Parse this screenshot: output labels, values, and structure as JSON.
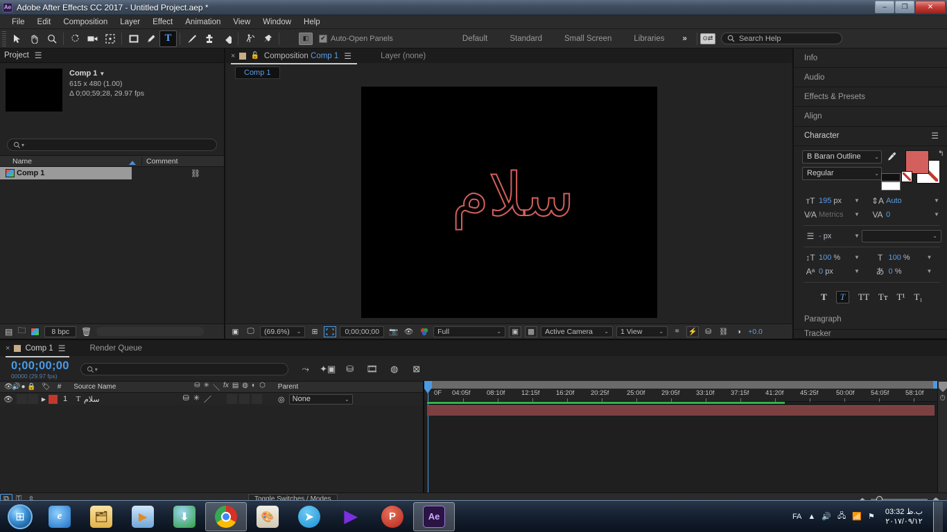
{
  "window": {
    "app_badge": "Ae",
    "title": "Adobe After Effects CC 2017 - Untitled Project.aep *",
    "minimize": "–",
    "restore": "❐",
    "close": "✕"
  },
  "menubar": [
    "File",
    "Edit",
    "Composition",
    "Layer",
    "Effect",
    "Animation",
    "View",
    "Window",
    "Help"
  ],
  "toolbar": {
    "tools": [
      {
        "name": "selection-tool",
        "glyph": "➤",
        "active": false
      },
      {
        "name": "hand-tool",
        "glyph": "✋",
        "active": false
      },
      {
        "name": "zoom-tool",
        "glyph": "⌕",
        "active": false
      },
      {
        "name": "rotation-tool",
        "glyph": "↺",
        "active": false
      },
      {
        "name": "camera-tool",
        "glyph": "🎥",
        "active": false
      },
      {
        "name": "pan-behind-tool",
        "glyph": "⛶",
        "active": false
      },
      {
        "name": "shape-tool",
        "glyph": "▢",
        "active": false
      },
      {
        "name": "pen-tool",
        "glyph": "✒",
        "active": false
      },
      {
        "name": "type-tool",
        "glyph": "T",
        "active": true
      },
      {
        "name": "brush-tool",
        "glyph": "🖌",
        "active": false
      },
      {
        "name": "clone-stamp-tool",
        "glyph": "⚱",
        "active": false
      },
      {
        "name": "eraser-tool",
        "glyph": "◆",
        "active": false
      },
      {
        "name": "roto-brush-tool",
        "glyph": "🏃",
        "active": false
      },
      {
        "name": "puppet-tool",
        "glyph": "📌",
        "active": false
      }
    ],
    "auto_open_panels": "Auto-Open Panels",
    "auto_open_checked": true,
    "workspaces": [
      "Default",
      "Standard",
      "Small Screen",
      "Libraries"
    ],
    "workspace_overflow": "»",
    "search_help_placeholder": "Search Help"
  },
  "project": {
    "tab_label": "Project",
    "comp_name": "Comp 1",
    "comp_dimensions": "615 x 480 (1.00)",
    "comp_duration": "Δ 0;00;59;28, 29.97 fps",
    "search_placeholder": "",
    "columns": {
      "name": "Name",
      "comment": "Comment"
    },
    "items": [
      {
        "name": "Comp 1",
        "selected": true
      }
    ],
    "bit_depth": "8 bpc"
  },
  "composition": {
    "tab_prefix": "Composition",
    "tab_name": "Comp 1",
    "layer_label": "Layer (none)",
    "sub_tab": "Comp 1",
    "canvas_text": "سلام",
    "text_color": "#d4605e",
    "footer": {
      "magnification": "(69.6%)",
      "timecode": "0;00;00;00",
      "resolution": "Full",
      "camera": "Active Camera",
      "views": "1 View",
      "exposure": "+0.0"
    }
  },
  "right_panels": {
    "collapsed": [
      "Info",
      "Audio",
      "Effects & Presets",
      "Align"
    ],
    "character": {
      "title": "Character",
      "font_family": "B Baran Outline",
      "font_style": "Regular",
      "font_size": "195",
      "font_size_unit": "px",
      "leading": "Auto",
      "kerning": "Metrics",
      "tracking": "0",
      "stroke_width": "-",
      "stroke_width_unit": "px",
      "stroke_type": "",
      "vertical_scale": "100",
      "vertical_scale_unit": "%",
      "horizontal_scale": "100",
      "horizontal_scale_unit": "%",
      "baseline_shift": "0",
      "baseline_shift_unit": "px",
      "tsume": "0",
      "tsume_unit": "%",
      "fill_color": "#d4605e",
      "style_buttons": [
        "T",
        "T",
        "TT",
        "Tᴛ",
        "T¹",
        "T₁"
      ],
      "style_selected_index": 1
    },
    "after_character": [
      "Paragraph",
      "Tracker"
    ]
  },
  "timeline": {
    "tabs": {
      "comp": "Comp 1",
      "render_queue": "Render Queue"
    },
    "current_time": "0;00;00;00",
    "frame_info": "00000 (29.97 fps)",
    "search_placeholder": "",
    "columns": {
      "source_name": "Source Name",
      "parent": "Parent",
      "number": "#"
    },
    "layers": [
      {
        "index": "1",
        "name": "سلام",
        "color": "#c0392b",
        "parent": "None",
        "visible": true
      }
    ],
    "ruler_labels": [
      "0F",
      "04:05f",
      "08:10f",
      "12:15f",
      "16:20f",
      "20:25f",
      "25:00f",
      "29:05f",
      "33:10f",
      "37:15f",
      "41:20f",
      "45:25f",
      "50:00f",
      "54:05f",
      "58:10f"
    ],
    "toggle_switches_modes": "Toggle Switches / Modes"
  },
  "taskbar": {
    "apps": [
      {
        "name": "internet-explorer",
        "glyph": "e",
        "color": "#1e6fc4",
        "active": false
      },
      {
        "name": "file-explorer",
        "glyph": "🗂",
        "color": "#e0b24a",
        "active": false
      },
      {
        "name": "media-player",
        "glyph": "▶",
        "color": "#e08a22",
        "active": false
      },
      {
        "name": "internet-download-manager",
        "glyph": "⬇",
        "color": "#2e9e3e",
        "active": false
      },
      {
        "name": "google-chrome",
        "glyph": "◎",
        "color": "#d93025",
        "active": true
      },
      {
        "name": "paint",
        "glyph": "🎨",
        "color": "#d7d2c3",
        "active": false
      },
      {
        "name": "telegram",
        "glyph": "➤",
        "color": "#2aa3e0",
        "active": false
      },
      {
        "name": "potplayer",
        "glyph": "▶",
        "color": "#7b2fe0",
        "active": false
      },
      {
        "name": "pot-player-alt",
        "glyph": "P",
        "color": "#c93a22",
        "active": false
      },
      {
        "name": "adobe-after-effects",
        "glyph": "Ae",
        "color": "#3a1f63",
        "active": true
      }
    ],
    "language": "FA",
    "time": "ب.ظ 03:32",
    "date": "۲۰۱۷/۰۹/۱۲"
  }
}
